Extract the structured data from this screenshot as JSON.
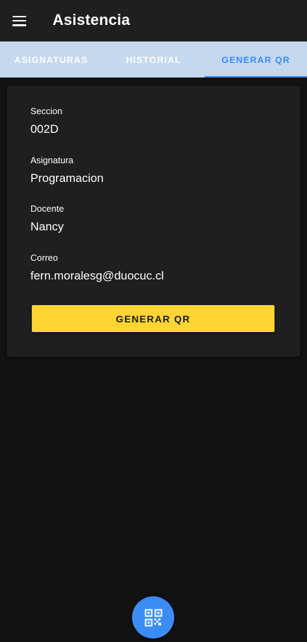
{
  "header": {
    "title": "Asistencia",
    "menu_icon": "hamburger-menu-icon"
  },
  "tabs": [
    {
      "label": "ASIGNATURAS",
      "active": false
    },
    {
      "label": "HISTORIAL",
      "active": false
    },
    {
      "label": "GENERAR QR",
      "active": true
    }
  ],
  "details": {
    "seccion": {
      "label": "Seccion",
      "value": "002D"
    },
    "asignatura": {
      "label": "Asignatura",
      "value": "Programacion"
    },
    "docente": {
      "label": "Docente",
      "value": "Nancy"
    },
    "correo": {
      "label": "Correo",
      "value": "fern.moralesg@duocuc.cl"
    }
  },
  "actions": {
    "generate_label": "GENERAR QR"
  },
  "fab": {
    "icon": "qr-code-icon"
  },
  "colors": {
    "background": "#121212",
    "toolbar": "#1f1f1f",
    "tab_bar": "#c4d9ee",
    "accent": "#3c8cf5",
    "button": "#ffd534",
    "card": "#1f1f1f"
  }
}
